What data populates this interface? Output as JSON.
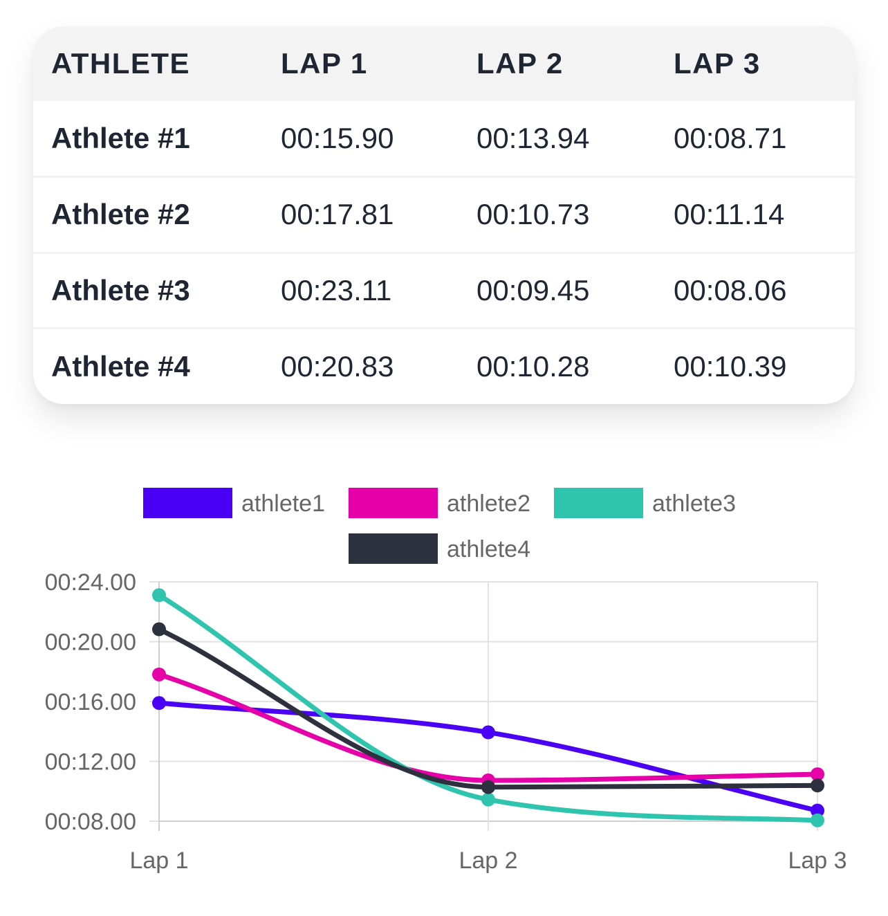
{
  "table": {
    "headers": [
      "ATHLETE",
      "LAP 1",
      "LAP 2",
      "LAP 3"
    ],
    "rows": [
      {
        "name": "Athlete #1",
        "times": [
          "00:15.90",
          "00:13.94",
          "00:08.71"
        ]
      },
      {
        "name": "Athlete #2",
        "times": [
          "00:17.81",
          "00:10.73",
          "00:11.14"
        ]
      },
      {
        "name": "Athlete #3",
        "times": [
          "00:23.11",
          "00:09.45",
          "00:08.06"
        ]
      },
      {
        "name": "Athlete #4",
        "times": [
          "00:20.83",
          "00:10.28",
          "00:10.39"
        ]
      }
    ]
  },
  "chart_data": {
    "type": "line",
    "categories": [
      "Lap 1",
      "Lap 2",
      "Lap 3"
    ],
    "series": [
      {
        "name": "athlete1",
        "color": "#4a00f5",
        "values": [
          15.9,
          13.94,
          8.71
        ]
      },
      {
        "name": "athlete2",
        "color": "#e600a8",
        "values": [
          17.81,
          10.73,
          11.14
        ]
      },
      {
        "name": "athlete3",
        "color": "#2ec4ad",
        "values": [
          23.11,
          9.45,
          8.06
        ]
      },
      {
        "name": "athlete4",
        "color": "#2d313e",
        "values": [
          20.83,
          10.28,
          10.39
        ]
      }
    ],
    "ylim": [
      8,
      24
    ],
    "yticks": [
      24,
      20,
      16,
      12,
      8
    ],
    "ytick_labels": [
      "00:24.00",
      "00:20.00",
      "00:16.00",
      "00:12.00",
      "00:08.00"
    ],
    "grid": true,
    "legend_position": "top-center"
  }
}
